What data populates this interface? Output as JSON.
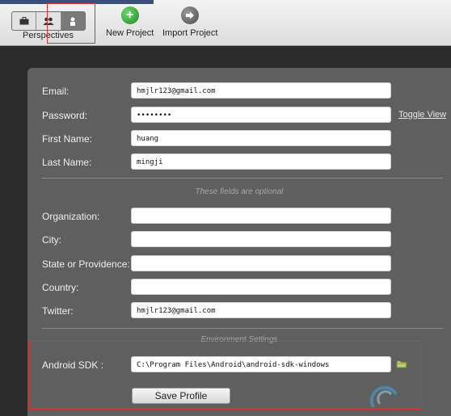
{
  "toolbar": {
    "perspectives_label": "Perspectives",
    "perspectives": [
      {
        "icon": "briefcase-icon",
        "active": false
      },
      {
        "icon": "users-icon",
        "active": false
      },
      {
        "icon": "user-icon",
        "active": true
      }
    ],
    "new_project_label": "New Project",
    "new_project_icon": "plus-icon",
    "import_project_label": "Import Project",
    "import_project_icon": "import-arrow-icon"
  },
  "profile": {
    "email": {
      "label": "Email:",
      "value": "hmjlr123@gmail.com"
    },
    "password": {
      "label": "Password:",
      "value": "••••••••",
      "toggle_label": "Toggle View"
    },
    "first_name": {
      "label": "First Name:",
      "value": "huang"
    },
    "last_name": {
      "label": "Last Name:",
      "value": "mingji"
    },
    "optional_note": "These fields are optional",
    "organization": {
      "label": "Organization:",
      "value": ""
    },
    "city": {
      "label": "City:",
      "value": ""
    },
    "state": {
      "label": "State or Providence:",
      "value": ""
    },
    "country": {
      "label": "Country:",
      "value": ""
    },
    "twitter": {
      "label": "Twitter:",
      "value": "hmjlr123@gmail.com"
    },
    "environment_heading": "Environment Settings",
    "android_sdk": {
      "label": "Android SDK :",
      "value": "C:\\Program Files\\Android\\android-sdk-windows",
      "browse_icon": "folder-icon"
    },
    "save_label": "Save Profile"
  },
  "colors": {
    "panel": "#5f5f5f",
    "background": "#2b2b2b",
    "new_project_green": "#2e9a2e",
    "highlight_red": "#dd3333"
  }
}
